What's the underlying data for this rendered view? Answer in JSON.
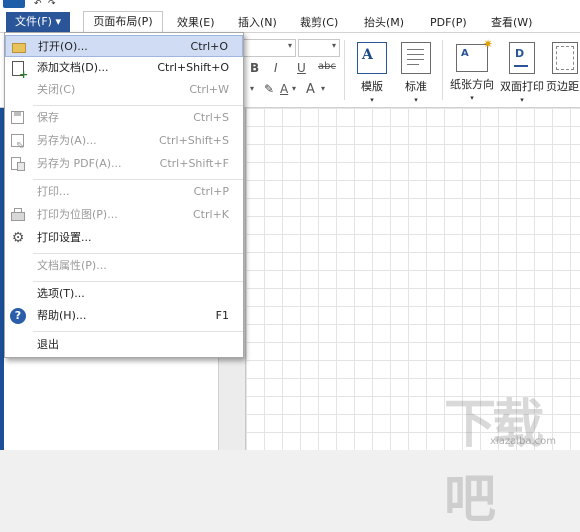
{
  "menubar": {
    "tabs": [
      {
        "label": "文件(F) ▾"
      },
      {
        "label": "页面布局(P)"
      },
      {
        "label": "效果(E)"
      },
      {
        "label": "插入(N)"
      },
      {
        "label": "裁剪(C)"
      },
      {
        "label": "抬头(M)"
      },
      {
        "label": "PDF(P)"
      },
      {
        "label": "查看(W)"
      }
    ]
  },
  "ribbon": {
    "format_bold": "B",
    "format_italic": "I",
    "format_underline": "U",
    "format_strike": "abc",
    "font_color": "A",
    "font_size": "A",
    "buttons": [
      {
        "label": "模版"
      },
      {
        "label": "标准"
      },
      {
        "label": "纸张方向"
      },
      {
        "label": "双面打印"
      },
      {
        "label": "页边距"
      }
    ]
  },
  "file_menu": {
    "items": [
      {
        "label": "打开(O)...",
        "shortcut": "Ctrl+O"
      },
      {
        "label": "添加文档(D)...",
        "shortcut": "Ctrl+Shift+O"
      },
      {
        "label": "关闭(C)",
        "shortcut": "Ctrl+W"
      },
      {
        "label": "保存",
        "shortcut": "Ctrl+S"
      },
      {
        "label": "另存为(A)...",
        "shortcut": "Ctrl+Shift+S"
      },
      {
        "label": "另存为 PDF(A)...",
        "shortcut": "Ctrl+Shift+F"
      },
      {
        "label": "打印...",
        "shortcut": "Ctrl+P"
      },
      {
        "label": "打印为位图(P)...",
        "shortcut": "Ctrl+K"
      },
      {
        "label": "打印设置...",
        "shortcut": ""
      },
      {
        "label": "文档属性(P)...",
        "shortcut": ""
      },
      {
        "label": "选项(T)...",
        "shortcut": ""
      },
      {
        "label": "帮助(H)...",
        "shortcut": "F1"
      },
      {
        "label": "退出",
        "shortcut": ""
      }
    ]
  },
  "watermark": {
    "text": "xiazaiba.com"
  },
  "colors": {
    "accent": "#2a5699",
    "highlight": "#cfdcf3"
  }
}
